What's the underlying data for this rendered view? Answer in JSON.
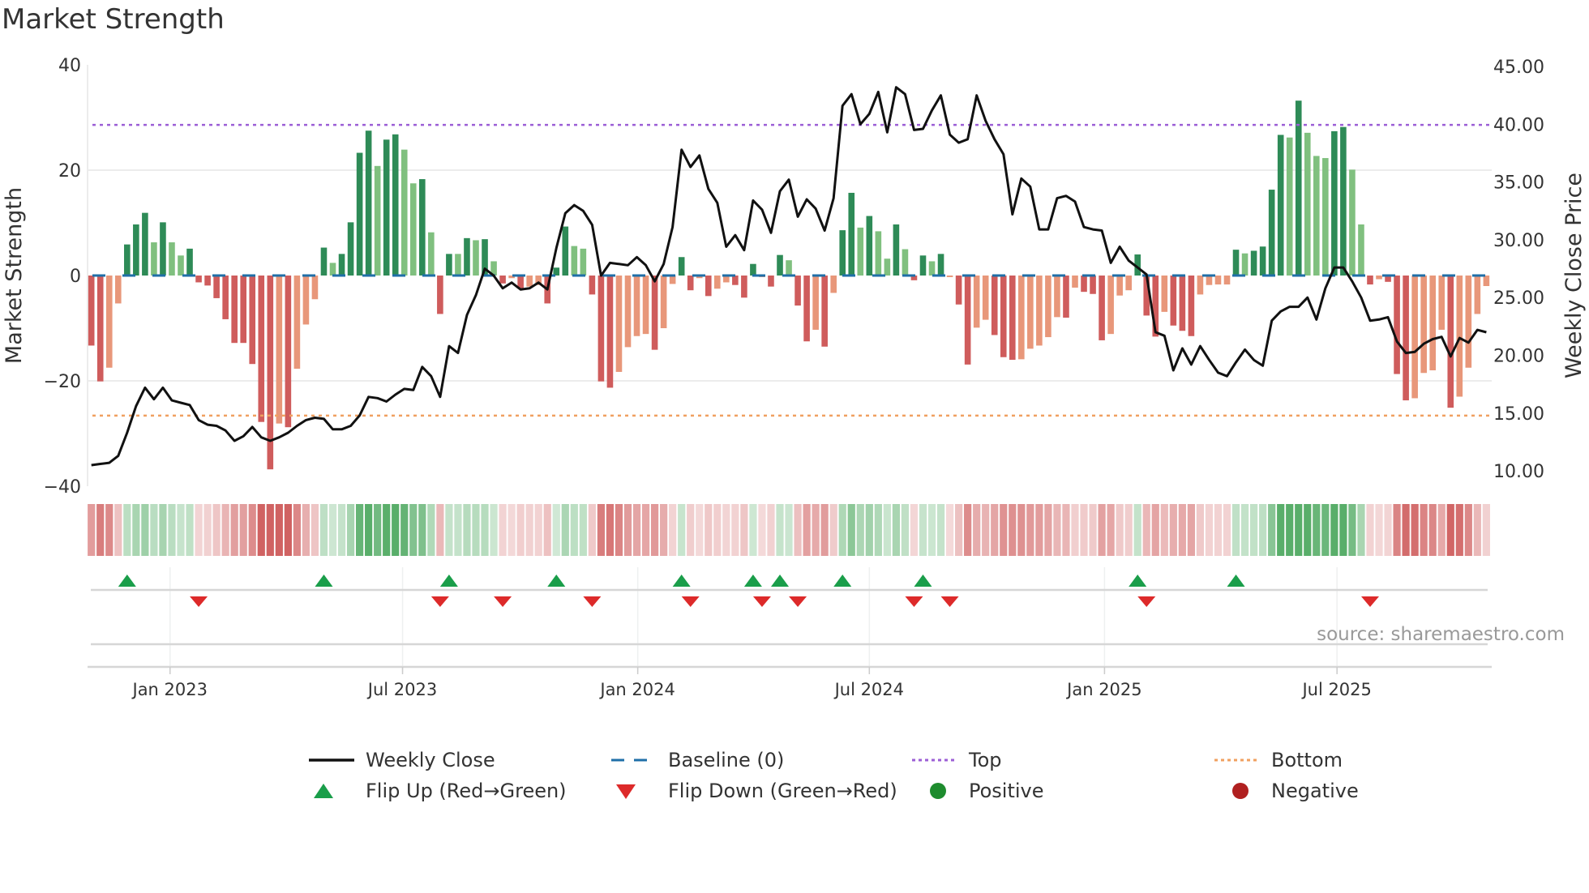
{
  "title": "Market Strength",
  "source": "source: sharemaestro.com",
  "colors": {
    "strong_green": "#2e8b57",
    "weak_green": "#80c07f",
    "strong_red": "#cf5c5c",
    "weak_red": "#e8977a",
    "line": "#111111",
    "baseline": "#1f6fa8",
    "top": "#9c5fd6",
    "bottom": "#f0a060",
    "flip_up": "#1a9e4a",
    "flip_down": "#dd2a2a",
    "positive": "#1e8c2e",
    "negative": "#b02020"
  },
  "legend": [
    {
      "label": "Weekly Close",
      "icon": "line-icon"
    },
    {
      "label": "Baseline (0)",
      "icon": "dashed-line-icon"
    },
    {
      "label": "Top",
      "icon": "dotted-line-icon"
    },
    {
      "label": "Bottom",
      "icon": "dotted-line-icon"
    },
    {
      "label": "Flip Up (Red→Green)",
      "icon": "triangle-up-icon"
    },
    {
      "label": "Flip Down (Green→Red)",
      "icon": "triangle-down-icon"
    },
    {
      "label": "Positive",
      "icon": "circle-icon"
    },
    {
      "label": "Negative",
      "icon": "circle-icon"
    }
  ],
  "chart_data": {
    "type": "bar",
    "title": "Market Strength",
    "ylabel": "Market Strength",
    "y2label": "Weekly Close Price",
    "ylim": [
      -40,
      40
    ],
    "y2lim": [
      7.5,
      45
    ],
    "yticks": [
      "40",
      "20",
      "0",
      "−20",
      "−40"
    ],
    "yticks_values": [
      40,
      20,
      0,
      -20,
      -40
    ],
    "y2ticks": [
      "45.00",
      "40.00",
      "35.00",
      "30.00",
      "25.00",
      "20.00",
      "15.00",
      "10.00"
    ],
    "y2ticks_values": [
      45,
      40,
      35,
      30,
      25,
      20,
      15,
      10
    ],
    "top_level": 28.6,
    "bottom_level": -26.6,
    "baseline": 0,
    "x_unit": "week index",
    "xticks": [
      {
        "label": "Jan 2023",
        "week": 9.8
      },
      {
        "label": "Jul 2023",
        "week": 35.8
      },
      {
        "label": "Jan 2024",
        "week": 62.1
      },
      {
        "label": "Jul 2024",
        "week": 88.0
      },
      {
        "label": "Jan 2025",
        "week": 114.3
      },
      {
        "label": "Jul 2025",
        "week": 140.3
      }
    ],
    "strength": [
      -13.3,
      -20.1,
      -17.5,
      -5.3,
      5.9,
      9.7,
      11.9,
      6.3,
      10.1,
      6.3,
      3.8,
      5.1,
      -1.3,
      -1.9,
      -4.3,
      -8.3,
      -12.8,
      -12.8,
      -16.8,
      -27.8,
      -36.8,
      -28.1,
      -28.8,
      -17.7,
      -9.3,
      -4.5,
      5.3,
      2.4,
      4.1,
      10.1,
      23.3,
      27.5,
      20.8,
      25.8,
      26.8,
      23.9,
      17.5,
      18.3,
      8.2,
      -7.3,
      4.1,
      4.1,
      7.1,
      6.7,
      6.9,
      2.7,
      -1.5,
      -0.5,
      -2.5,
      -2.1,
      -1.8,
      -5.3,
      1.5,
      9.3,
      5.6,
      5.1,
      -3.6,
      -20.1,
      -21.3,
      -18.3,
      -13.6,
      -11.5,
      -11.1,
      -14.1,
      -10.0,
      -1.6,
      3.5,
      -2.8,
      -0.5,
      -3.9,
      -2.5,
      -1.3,
      -1.8,
      -4.2,
      2.2,
      -0.3,
      -2.1,
      3.9,
      2.9,
      -5.7,
      -12.5,
      -10.3,
      -13.5,
      -3.3,
      8.6,
      15.7,
      9.1,
      11.3,
      8.4,
      3.2,
      9.7,
      5.0,
      -0.9,
      3.8,
      2.7,
      4.1,
      -0.3,
      -5.5,
      -16.9,
      -9.9,
      -8.4,
      -11.3,
      -15.5,
      -16.0,
      -15.9,
      -13.9,
      -13.3,
      -11.7,
      -7.9,
      -8.0,
      -2.3,
      -3.1,
      -3.5,
      -12.3,
      -11.1,
      -3.8,
      -2.8,
      4.0,
      -7.6,
      -11.6,
      -6.9,
      -9.5,
      -10.5,
      -11.5,
      -3.6,
      -1.8,
      -1.7,
      -1.7,
      4.9,
      4.2,
      4.7,
      5.5,
      16.3,
      26.7,
      26.2,
      33.2,
      27.1,
      22.7,
      22.3,
      27.4,
      28.2,
      20.1,
      9.7,
      -1.7,
      -0.7,
      -1.2,
      -18.7,
      -23.7,
      -23.3,
      -18.5,
      -18.0,
      -10.3,
      -25.1,
      -23.0,
      -17.5,
      -7.3,
      -2.0
    ],
    "strength_class": "RRrrGGGgGggGRRRRRRRRRrRrrrGgGGGGgGGggGgRGgGgGgRrRrrRGGggRRRrrrrRrrGRrRrrRRGrRGgRRrRrGGgGggGgRGgGrRRrrRRRrrrrrRrRRRrrrGRRrRRRrrrrGgGGGGgGgggGGggRrRRRrrrrRrrrr",
    "weekly_close": [
      10.5,
      10.6,
      10.7,
      11.3,
      13.3,
      15.6,
      17.2,
      16.2,
      17.2,
      16.1,
      15.9,
      15.7,
      14.4,
      14.0,
      13.9,
      13.5,
      12.6,
      13.0,
      13.8,
      12.9,
      12.6,
      12.9,
      13.3,
      13.9,
      14.4,
      14.6,
      14.5,
      13.6,
      13.6,
      13.9,
      14.8,
      16.4,
      16.3,
      16.0,
      16.6,
      17.1,
      17.0,
      19.0,
      18.2,
      16.4,
      20.8,
      20.2,
      23.5,
      25.2,
      27.5,
      26.9,
      25.8,
      26.3,
      25.7,
      25.8,
      26.3,
      25.7,
      29.3,
      32.3,
      33.0,
      32.5,
      31.3,
      26.9,
      28.0,
      27.9,
      27.8,
      28.5,
      27.8,
      26.4,
      27.9,
      31.1,
      37.8,
      36.3,
      37.3,
      34.4,
      33.2,
      29.4,
      30.4,
      29.1,
      33.4,
      32.6,
      30.6,
      34.2,
      35.2,
      32.0,
      33.5,
      32.7,
      30.8,
      33.6,
      41.6,
      42.6,
      40.0,
      40.9,
      42.8,
      39.3,
      43.2,
      42.6,
      39.5,
      39.6,
      41.2,
      42.5,
      39.1,
      38.4,
      38.7,
      42.5,
      40.3,
      38.7,
      37.4,
      32.2,
      35.3,
      34.6,
      30.9,
      30.9,
      33.6,
      33.8,
      33.3,
      31.1,
      30.9,
      30.8,
      28.0,
      29.4,
      28.2,
      27.6,
      27.0,
      22.0,
      21.7,
      18.7,
      20.6,
      19.2,
      20.8,
      19.6,
      18.5,
      18.2,
      19.4,
      20.5,
      19.6,
      19.1,
      23.0,
      23.8,
      24.2,
      24.2,
      25.0,
      23.1,
      25.8,
      27.6,
      27.6,
      26.4,
      25.0,
      23.0,
      23.1,
      23.3,
      21.2,
      20.2,
      20.3,
      21.0,
      21.4,
      21.6,
      19.9,
      21.5,
      21.1,
      22.2,
      22.0
    ],
    "flip_up_weeks": [
      5,
      27,
      41,
      53,
      67,
      75,
      78,
      85,
      94,
      118,
      129
    ],
    "flip_down_weeks": [
      13,
      40,
      47,
      57,
      68,
      76,
      80,
      93,
      97,
      119,
      144
    ]
  }
}
